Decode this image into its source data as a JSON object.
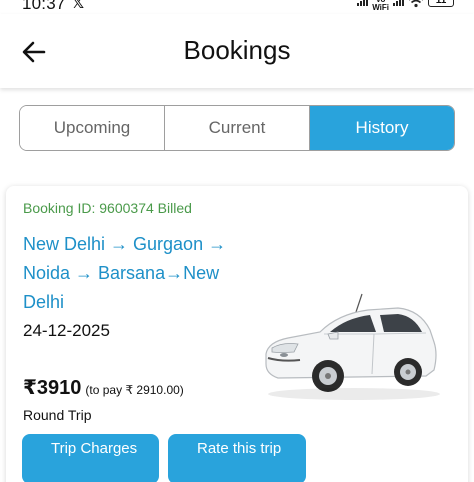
{
  "status_bar": {
    "time": "10:37",
    "x_glyph": "𝕏",
    "dots": "•••",
    "wifi_label": "Vo\nWiFi",
    "battery": "11"
  },
  "header": {
    "back_icon": "arrow-left-icon",
    "title": "Bookings"
  },
  "tabs": [
    {
      "label": "Upcoming",
      "active": false
    },
    {
      "label": "Current",
      "active": false
    },
    {
      "label": "History",
      "active": true
    }
  ],
  "booking": {
    "id_text": "Booking ID: 9600374 Billed",
    "route": "New Delhi → Gurgaon → Noida → Barsana→New Delhi",
    "date": "24-12-2025",
    "price": "₹3910",
    "to_pay": "(to pay ₹ 2910.00)",
    "trip_type": "Round Trip",
    "car_image": "white-sedan-car",
    "buttons": {
      "trip_charges": "Trip Charges",
      "rate_trip": "Rate this trip"
    }
  },
  "colors": {
    "accent": "#29a3dc",
    "route_text": "#1e90c8",
    "booking_id_text": "#4a9a4a",
    "tab_border": "#9e9e9e"
  }
}
